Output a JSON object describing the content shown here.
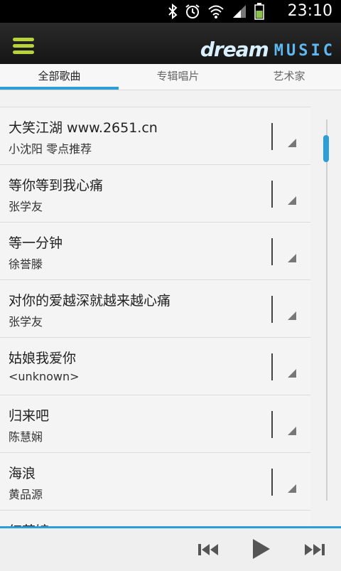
{
  "status_bar": {
    "time": "23:10",
    "icons": [
      "bluetooth-icon",
      "alarm-icon",
      "wifi-icon",
      "signal-icon",
      "battery-icon"
    ]
  },
  "header": {
    "brand_primary": "dream",
    "brand_secondary": "MUSIC",
    "menu_icon": "hamburger-menu-icon"
  },
  "tabs": [
    {
      "label": "全部歌曲",
      "active": true
    },
    {
      "label": "专辑唱片",
      "active": false
    },
    {
      "label": "艺术家",
      "active": false
    }
  ],
  "songs": [
    {
      "title": "大笑江湖 www.2651.cn",
      "artist": "小沈阳   零点推荐"
    },
    {
      "title": "等你等到我心痛",
      "artist": "张学友"
    },
    {
      "title": "等一分钟",
      "artist": "徐誉滕"
    },
    {
      "title": "对你的爱越深就越来越心痛",
      "artist": "张学友"
    },
    {
      "title": "姑娘我爱你",
      "artist": "<unknown>"
    },
    {
      "title": "归来吧",
      "artist": "陈慧娴"
    },
    {
      "title": "海浪",
      "artist": "黄品源"
    },
    {
      "title": "红茶馆",
      "artist": ""
    }
  ],
  "player": {
    "controls": [
      "previous-icon",
      "play-icon",
      "next-icon"
    ]
  },
  "colors": {
    "accent": "#2c9fd6",
    "menu_icon": "#b7d33a",
    "background": "#f2f2f2"
  }
}
